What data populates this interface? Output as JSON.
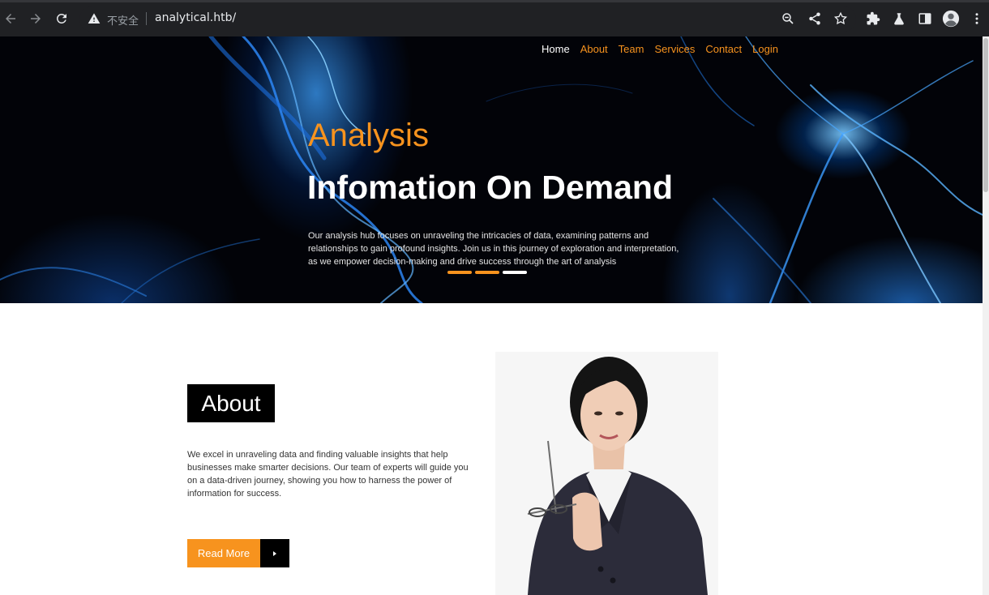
{
  "browser": {
    "security_label": "不安全",
    "url": "analytical.htb/"
  },
  "nav": {
    "items": [
      {
        "label": "Home",
        "active": true
      },
      {
        "label": "About"
      },
      {
        "label": "Team"
      },
      {
        "label": "Services"
      },
      {
        "label": "Contact"
      },
      {
        "label": "Login"
      }
    ]
  },
  "hero": {
    "kicker": "Analysis",
    "title": "Infomation On Demand",
    "text": "Our analysis hub focuses on unraveling the intricacies of data, examining patterns and relationships to gain profound insights. Join us in this journey of exploration and interpretation, as we empower decision-making and drive success through the art of analysis",
    "slides": 3,
    "active_slide": 3
  },
  "about": {
    "heading": "About",
    "text": "We excel in unraveling data and finding valuable insights that help businesses make smarter decisions. Our team of experts will guide you on a data-driven journey, showing you how to harness the power of information for success.",
    "button_label": "Read More"
  },
  "colors": {
    "accent": "#f7931e",
    "chrome_bg": "#202124",
    "hero_bg": "#020308"
  }
}
